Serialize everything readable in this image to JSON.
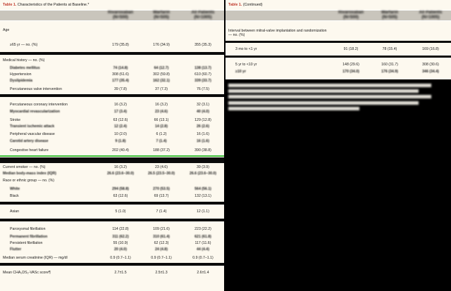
{
  "left_table": {
    "label": "Table 1.",
    "title": "Characteristics of the Patients at Baseline.*",
    "header": [
      "Rivaroxaban\n(N=500)",
      "Warfarin\n(N=505)",
      "All Patients\n(N=1005)"
    ],
    "rows": [
      {
        "label": "Age",
        "style": "section",
        "c1": "",
        "c2": "",
        "c3": ""
      },
      {
        "label": "",
        "style": "sub",
        "c1": "",
        "c2": "",
        "c3": ""
      },
      {
        "label": "≥65 yr — no. (%)",
        "style": "sub",
        "c1": "179 (35.8)",
        "c2": "176 (34.9)",
        "c3": "355 (35.3)"
      },
      {
        "label": "Medical history — no. (%)",
        "style": "section",
        "c1": "",
        "c2": "",
        "c3": ""
      },
      {
        "label": "Diabetes mellitus",
        "style": "sub bold",
        "c1": "74 (14.8)",
        "c2": "64 (12.7)",
        "c3": "138 (13.7)"
      },
      {
        "label": "Hypertension",
        "style": "sub",
        "c1": "308 (61.6)",
        "c2": "302 (59.8)",
        "c3": "610 (60.7)"
      },
      {
        "label": "Dyslipidemia",
        "style": "sub bold",
        "c1": "177 (35.4)",
        "c2": "162 (32.1)",
        "c3": "339 (33.7)"
      },
      {
        "label": "Percutaneous valve intervention",
        "style": "sub",
        "c1": "39 (7.8)",
        "c2": "37 (7.3)",
        "c3": "76 (7.5)"
      },
      {
        "label": "Percutaneous coronary intervention",
        "style": "sub",
        "c1": "16 (3.2)",
        "c2": "16 (3.2)",
        "c3": "32 (3.1)"
      },
      {
        "label": "Myocardial revascularization",
        "style": "sub bold",
        "c1": "17 (3.4)",
        "c2": "23 (4.6)",
        "c3": "40 (4.0)"
      },
      {
        "label": "Stroke",
        "style": "sub",
        "c1": "63 (12.6)",
        "c2": "66 (13.1)",
        "c3": "129 (12.8)"
      },
      {
        "label": "Transient ischemic attack",
        "style": "sub bold",
        "c1": "12 (2.4)",
        "c2": "14 (2.8)",
        "c3": "26 (2.6)"
      },
      {
        "label": "Peripheral vascular disease",
        "style": "sub",
        "c1": "10 (2.0)",
        "c2": "6 (1.2)",
        "c3": "16 (1.6)"
      },
      {
        "label": "Carotid artery disease",
        "style": "sub bold",
        "c1": "9 (1.8)",
        "c2": "7 (1.4)",
        "c3": "16 (1.6)"
      },
      {
        "label": "Congestive heart failure",
        "style": "sub",
        "c1": "202 (40.4)",
        "c2": "188 (37.2)",
        "c3": "390 (38.8)"
      },
      {
        "label": "Current smoker — no. (%)",
        "style": "section",
        "c1": "16 (3.2)",
        "c2": "23 (4.6)",
        "c3": "39 (3.9)"
      },
      {
        "label": "Median body-mass index (IQR)",
        "style": "section bold",
        "c1": "26.6 (23.6–30.0)",
        "c2": "26.5 (23.5–30.0)",
        "c3": "26.6 (23.6–30.0)"
      },
      {
        "label": "Race or ethnic group — no. (%)",
        "style": "section",
        "c1": "",
        "c2": "",
        "c3": ""
      },
      {
        "label": "White",
        "style": "sub bold",
        "c1": "294 (58.8)",
        "c2": "270 (53.5)",
        "c3": "564 (56.1)"
      },
      {
        "label": "Black",
        "style": "sub",
        "c1": "63 (12.6)",
        "c2": "69 (13.7)",
        "c3": "132 (13.1)"
      },
      {
        "label": "Asian",
        "style": "sub",
        "c1": "5 (1.0)",
        "c2": "7 (1.4)",
        "c3": "12 (1.1)"
      },
      {
        "label": "Paroxysmal fibrillation",
        "style": "sub",
        "c1": "114 (22.8)",
        "c2": "109 (21.6)",
        "c3": "223 (22.2)"
      },
      {
        "label": "Permanent fibrillation",
        "style": "sub bold",
        "c1": "311 (62.2)",
        "c2": "310 (61.4)",
        "c3": "621 (61.8)"
      },
      {
        "label": "Persistent fibrillation",
        "style": "sub",
        "c1": "55 (10.9)",
        "c2": "62 (12.3)",
        "c3": "117 (11.6)"
      },
      {
        "label": "Flutter",
        "style": "sub bold",
        "c1": "20 (4.0)",
        "c2": "24 (4.8)",
        "c3": "44 (4.4)"
      },
      {
        "label": "Median serum creatinine (IQR) — mg/dl",
        "style": "section",
        "c1": "0.9 (0.7–1.1)",
        "c2": "0.9 (0.7–1.1)",
        "c3": "0.9 (0.7–1.1)"
      },
      {
        "label": "Mean CHA₂DS₂-VASc score¶",
        "style": "section",
        "c1": "2.7±1.5",
        "c2": "2.5±1.3",
        "c3": "2.6±1.4"
      }
    ]
  },
  "right_table": {
    "label": "Table 1.",
    "title": "(Continued)",
    "header": [
      "Rivaroxaban\n(N=500)",
      "Warfarin\n(N=505)",
      "All Patients\n(N=1005)"
    ],
    "rows": [
      {
        "label": "Interval between mitral-valve implantation and randomization — no. (%)",
        "style": "note",
        "c1": "",
        "c2": "",
        "c3": ""
      },
      {
        "label": "3 mo to <1 yr",
        "style": "sub",
        "c1": "91 (18.2)",
        "c2": "78 (15.4)",
        "c3": "169 (16.8)"
      },
      {
        "label": "5 yr to <10 yr",
        "style": "sub",
        "c1": "148 (29.6)",
        "c2": "160 (31.7)",
        "c3": "308 (30.6)"
      },
      {
        "label": "≥10 yr",
        "style": "sub bold",
        "c1": "170 (34.0)",
        "c2": "176 (34.9)",
        "c3": "346 (34.4)"
      }
    ]
  },
  "footnote_lines": 5
}
